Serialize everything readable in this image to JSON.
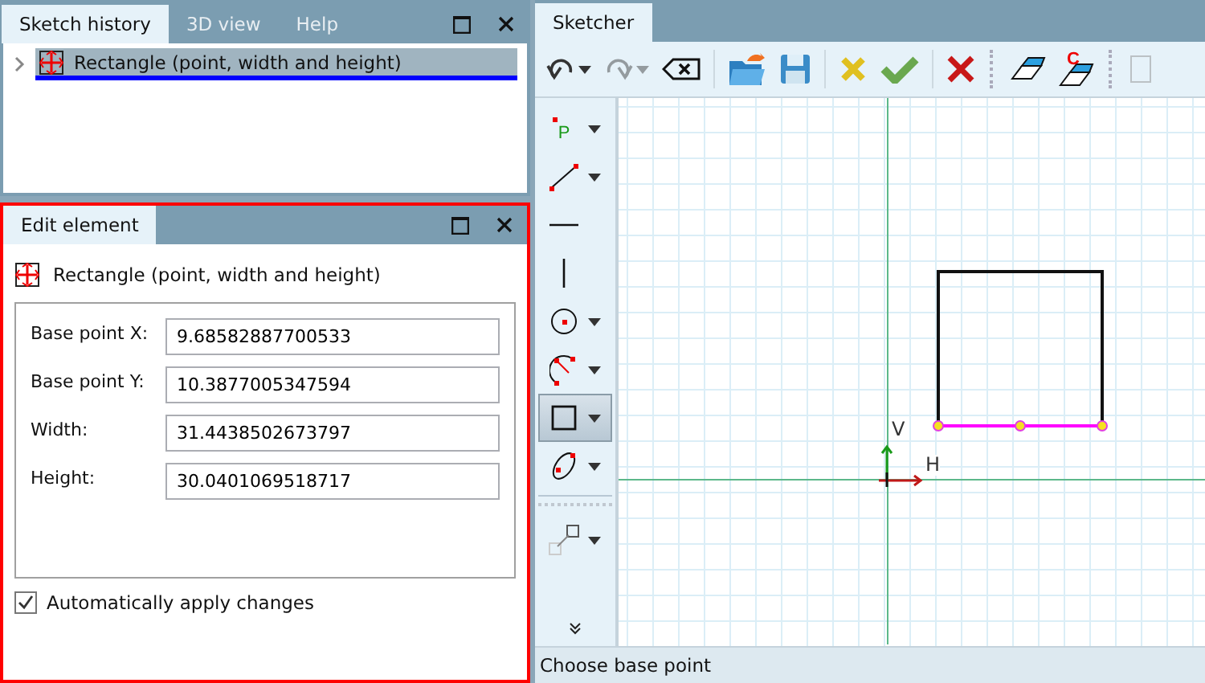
{
  "history_panel": {
    "tabs": [
      {
        "label": "Sketch history",
        "selected": true
      },
      {
        "label": "3D view",
        "selected": false
      },
      {
        "label": "Help",
        "selected": false
      }
    ],
    "items": [
      {
        "label": "Rectangle (point, width and height)",
        "selected": true,
        "expanded": false
      }
    ]
  },
  "edit_panel": {
    "tab": "Edit element",
    "element_title": "Rectangle (point, width and height)",
    "fields": [
      {
        "label": "Base point X:",
        "value": "9.68582887700533"
      },
      {
        "label": "Base point Y:",
        "value": "10.3877005347594"
      },
      {
        "label": "Width:",
        "value": "31.4438502673797"
      },
      {
        "label": "Height:",
        "value": "30.0401069518717"
      }
    ],
    "auto_apply": {
      "label": "Automatically apply changes",
      "checked": true
    }
  },
  "sketcher": {
    "tab": "Sketcher",
    "toolbar": [
      {
        "kind": "undo",
        "disabled": false,
        "dropdown": true
      },
      {
        "kind": "redo",
        "disabled": true,
        "dropdown": true
      },
      {
        "kind": "clear",
        "disabled": false,
        "dropdown": false
      },
      {
        "kind": "sep"
      },
      {
        "kind": "open",
        "disabled": false,
        "dropdown": false
      },
      {
        "kind": "save",
        "disabled": false,
        "dropdown": false
      },
      {
        "kind": "sep"
      },
      {
        "kind": "cancel-soft",
        "disabled": false,
        "dropdown": false
      },
      {
        "kind": "confirm",
        "disabled": false,
        "dropdown": false
      },
      {
        "kind": "sep"
      },
      {
        "kind": "delete",
        "disabled": false,
        "dropdown": false
      },
      {
        "kind": "grip"
      },
      {
        "kind": "eraser",
        "disabled": false,
        "dropdown": false
      },
      {
        "kind": "eraser-c",
        "disabled": false,
        "dropdown": false,
        "glyph": "C"
      },
      {
        "kind": "grip"
      },
      {
        "kind": "frame",
        "disabled": true,
        "dropdown": false
      }
    ],
    "tools": [
      {
        "kind": "point",
        "glyph": "P",
        "dropdown": true,
        "selected": false
      },
      {
        "kind": "line",
        "dropdown": true,
        "selected": false
      },
      {
        "kind": "hline",
        "dropdown": false,
        "selected": false
      },
      {
        "kind": "vline",
        "dropdown": false,
        "selected": false
      },
      {
        "kind": "circle",
        "dropdown": true,
        "selected": false
      },
      {
        "kind": "arc",
        "dropdown": true,
        "selected": false
      },
      {
        "kind": "rect",
        "dropdown": true,
        "selected": true
      },
      {
        "kind": "ellipse",
        "dropdown": true,
        "selected": false
      },
      {
        "kind": "grip"
      },
      {
        "kind": "move",
        "dropdown": true,
        "selected": false
      }
    ],
    "canvas": {
      "y_axis_label": "V",
      "x_axis_label": "H"
    },
    "status": "Choose base point"
  }
}
